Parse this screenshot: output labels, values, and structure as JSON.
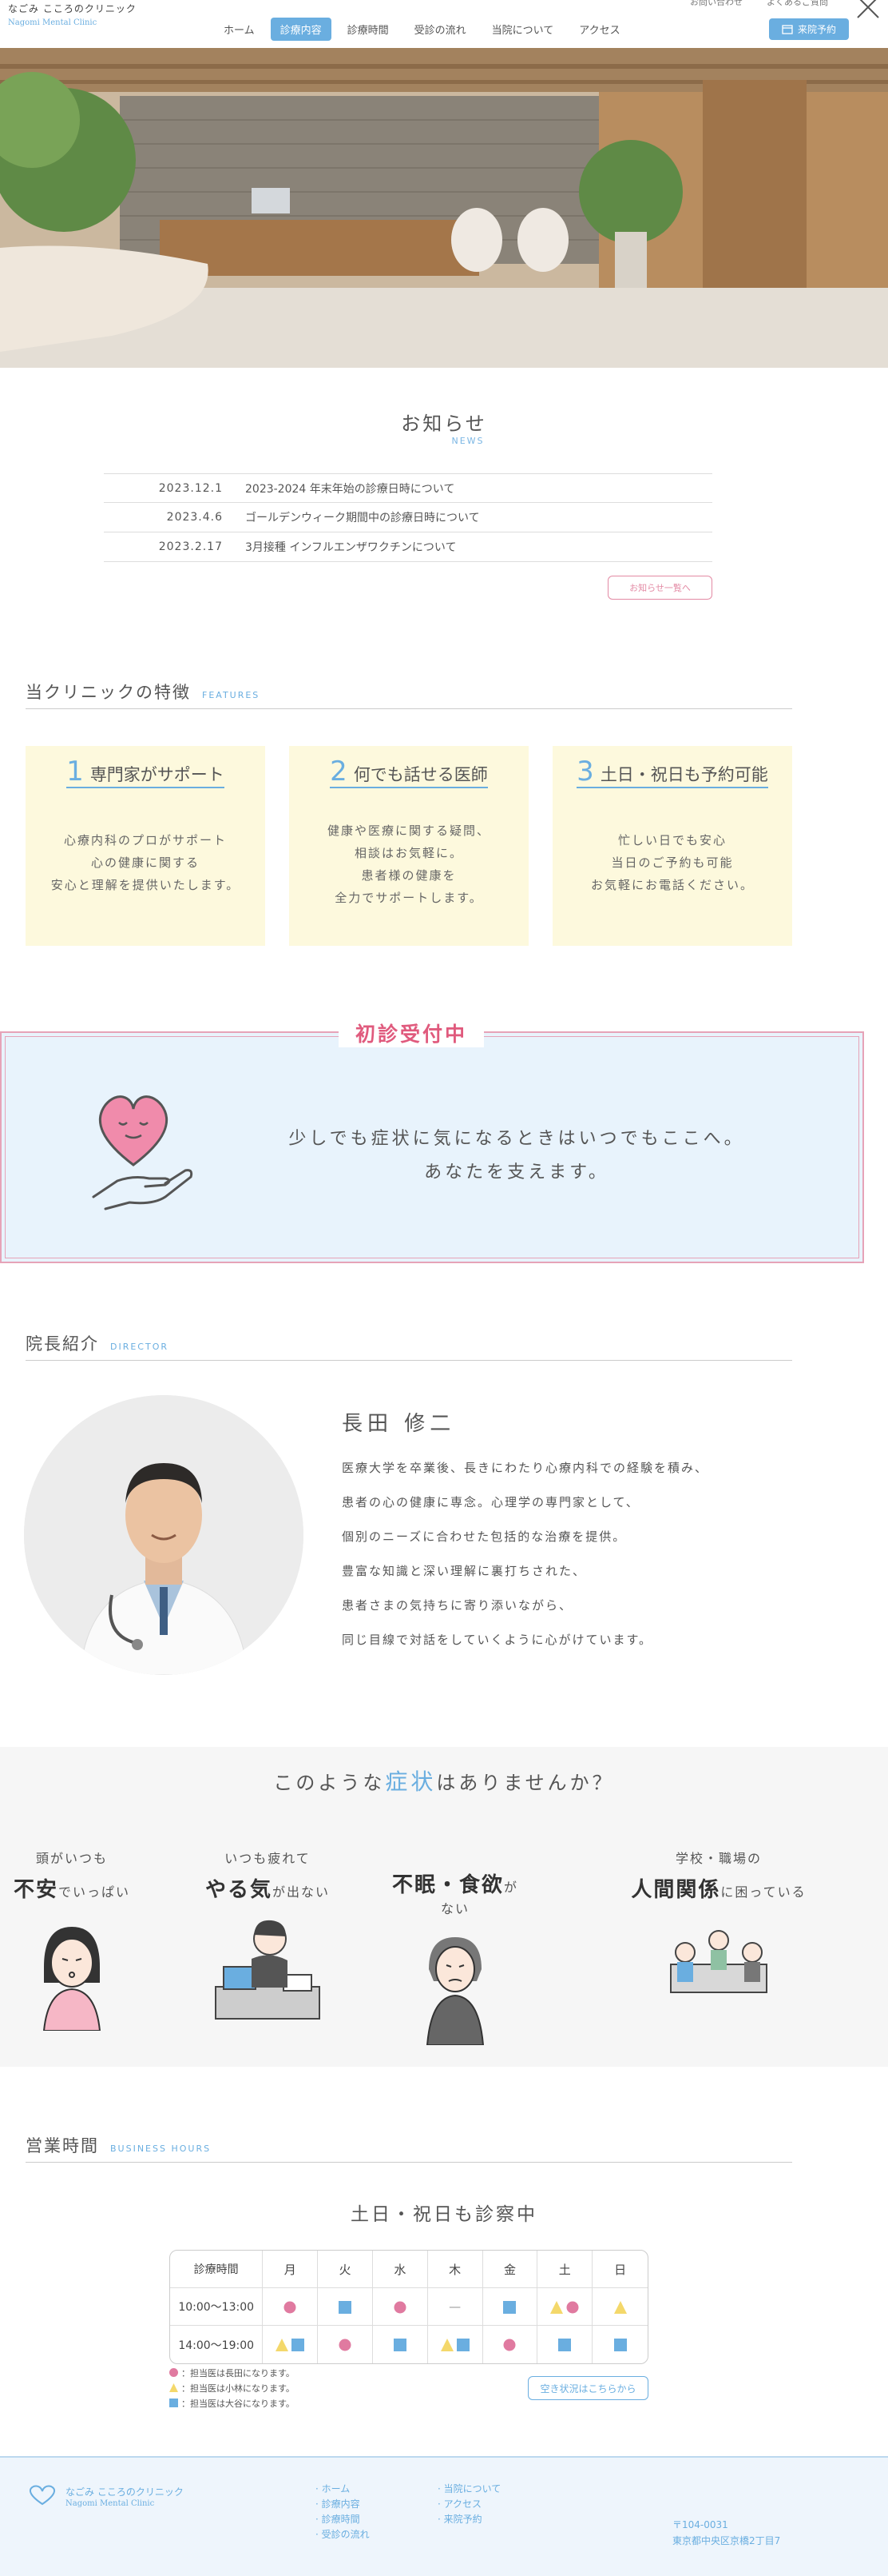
{
  "header": {
    "logo_jp": "なごみ こころのクリニック",
    "logo_en": "Nagomi Mental Clinic",
    "nav": [
      "ホーム",
      "診療内容",
      "診療時間",
      "受診の流れ",
      "当院について",
      "アクセス"
    ],
    "active_nav": "診療内容",
    "top_links": [
      "お問い合わせ",
      "よくあるご質問"
    ],
    "reserve": "来院予約"
  },
  "news": {
    "title": "お知らせ",
    "title_en": "NEWS",
    "items": [
      {
        "date": "2023.12.1",
        "text": "2023-2024 年末年始の診療日時について"
      },
      {
        "date": "2023.4.6",
        "text": "ゴールデンウィーク期間中の診療日時について"
      },
      {
        "date": "2023.2.17",
        "text": "3月接種 インフルエンザワクチンについて"
      }
    ],
    "more": "お知らせ一覧へ"
  },
  "features": {
    "title": "当クリニックの特徴",
    "title_en": "FEATURES",
    "items": [
      {
        "num": "1",
        "title": "専門家がサポート",
        "body": [
          "心療内科のプロがサポート",
          "心の健康に関する",
          "安心と理解を提供いたします。"
        ]
      },
      {
        "num": "2",
        "title": "何でも話せる医師",
        "body": [
          "健康や医療に関する疑問、",
          "相談はお気軽に。",
          "患者様の健康を",
          "全力でサポートします。"
        ]
      },
      {
        "num": "3",
        "title": "土日・祝日も予約可能",
        "body": [
          "忙しい日でも安心",
          "当日のご予約も可能",
          "お気軽にお電話ください。"
        ]
      }
    ]
  },
  "first_visit": {
    "label": "初診受付中",
    "message": [
      "少しでも症状に気になるときはいつでもここへ。",
      "あなたを支えます。"
    ]
  },
  "director": {
    "title": "院長紹介",
    "title_en": "DIRECTOR",
    "name": "長田 修二",
    "bio": [
      "医療大学を卒業後、長きにわたり心療内科での経験を積み、",
      "患者の心の健康に専念。心理学の専門家として、",
      "個別のニーズに合わせた包括的な治療を提供。",
      "豊富な知識と深い理解に裏打ちされた、",
      "患者さまの気持ちに寄り添いながら、",
      "同じ目線で対話をしていくように心がけています。"
    ]
  },
  "symptoms": {
    "title_pre": "このような",
    "title_hl": "症状",
    "title_post": "はありませんか？",
    "items": [
      {
        "line1": "頭がいつも",
        "strong": "不安",
        "rest": "でいっぱい"
      },
      {
        "line1": "いつも疲れて",
        "strong": "やる気",
        "rest": "が出ない"
      },
      {
        "line1": "",
        "strong": "不眠・食欲",
        "rest": "がない"
      },
      {
        "line1": "学校・職場の",
        "strong": "人間関係",
        "rest": "に困っている"
      }
    ]
  },
  "hours": {
    "title": "営業時間",
    "title_en": "BUSINESS HOURS",
    "subtitle": "土日・祝日も診察中",
    "header": [
      "診療時間",
      "月",
      "火",
      "水",
      "木",
      "金",
      "土",
      "日"
    ],
    "rows": [
      {
        "time": "10:00〜13:00",
        "cells": [
          [
            "circle"
          ],
          [
            "square"
          ],
          [
            "circle"
          ],
          [
            "dash"
          ],
          [
            "square"
          ],
          [
            "triangle",
            "circle"
          ],
          [
            "triangle"
          ]
        ]
      },
      {
        "time": "14:00〜19:00",
        "cells": [
          [
            "triangle",
            "square"
          ],
          [
            "circle"
          ],
          [
            "square"
          ],
          [
            "triangle",
            "square"
          ],
          [
            "circle"
          ],
          [
            "square"
          ],
          [
            "square"
          ]
        ]
      }
    ],
    "dash": "—",
    "legend": [
      "：担当医は長田になります。",
      "：担当医は小林になります。",
      "：担当医は大谷になります。"
    ],
    "vacancy": "空き状況はこちらから"
  },
  "footer": {
    "logo_jp": "なごみ こころのクリニック",
    "logo_en": "Nagomi Mental Clinic",
    "col1": [
      "ホーム",
      "診療内容",
      "診療時間",
      "受診の流れ"
    ],
    "col2": [
      "当院について",
      "アクセス",
      "来院予約"
    ],
    "zip": "〒104-0031",
    "address": "東京都中央区京橋2丁目7"
  },
  "colors": {
    "accent": "#6aaee0",
    "pink": "#e07aa0",
    "yellow": "#f4d86b",
    "blue": "#6aaee0"
  }
}
